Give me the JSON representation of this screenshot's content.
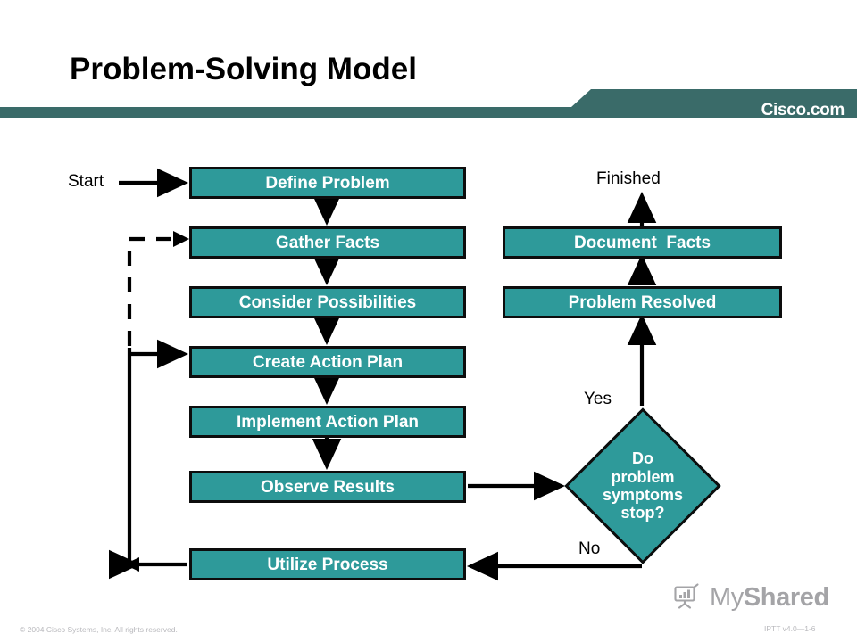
{
  "slide": {
    "title": "Problem-Solving Model",
    "brand_wordmark": "Cisco.com",
    "accent_color": "#2E9A9A",
    "banner_color": "#3A6B69",
    "outline_color": "#0d0d0d",
    "text_on_accent": "#FFFFFF"
  },
  "flow": {
    "left_column": [
      {
        "id": "define-problem",
        "label": "Define Problem"
      },
      {
        "id": "gather-facts",
        "label": "Gather Facts"
      },
      {
        "id": "consider-possibilities",
        "label": "Consider Possibilities"
      },
      {
        "id": "create-action-plan",
        "label": "Create Action Plan"
      },
      {
        "id": "implement-action-plan",
        "label": "Implement Action Plan"
      },
      {
        "id": "observe-results",
        "label": "Observe Results"
      },
      {
        "id": "utilize-process",
        "label": "Utilize Process"
      }
    ],
    "right_column": [
      {
        "id": "document-facts",
        "label": "Document  Facts"
      },
      {
        "id": "problem-resolved",
        "label": "Problem Resolved"
      }
    ],
    "decision": {
      "id": "do-problem-symptoms-stop",
      "lines": [
        "Do",
        "problem",
        "symptoms",
        "stop?"
      ]
    },
    "annotations": {
      "start": "Start",
      "finished": "Finished",
      "yes": "Yes",
      "no": "No"
    }
  },
  "watermark": {
    "brand_prefix": "My",
    "brand_suffix": "Shared",
    "icon": "presentation-chart-icon"
  },
  "footer": {
    "copyright": "© 2004 Cisco Systems, Inc. All rights reserved.",
    "document_id": "IPTT v4.0—1-6"
  }
}
